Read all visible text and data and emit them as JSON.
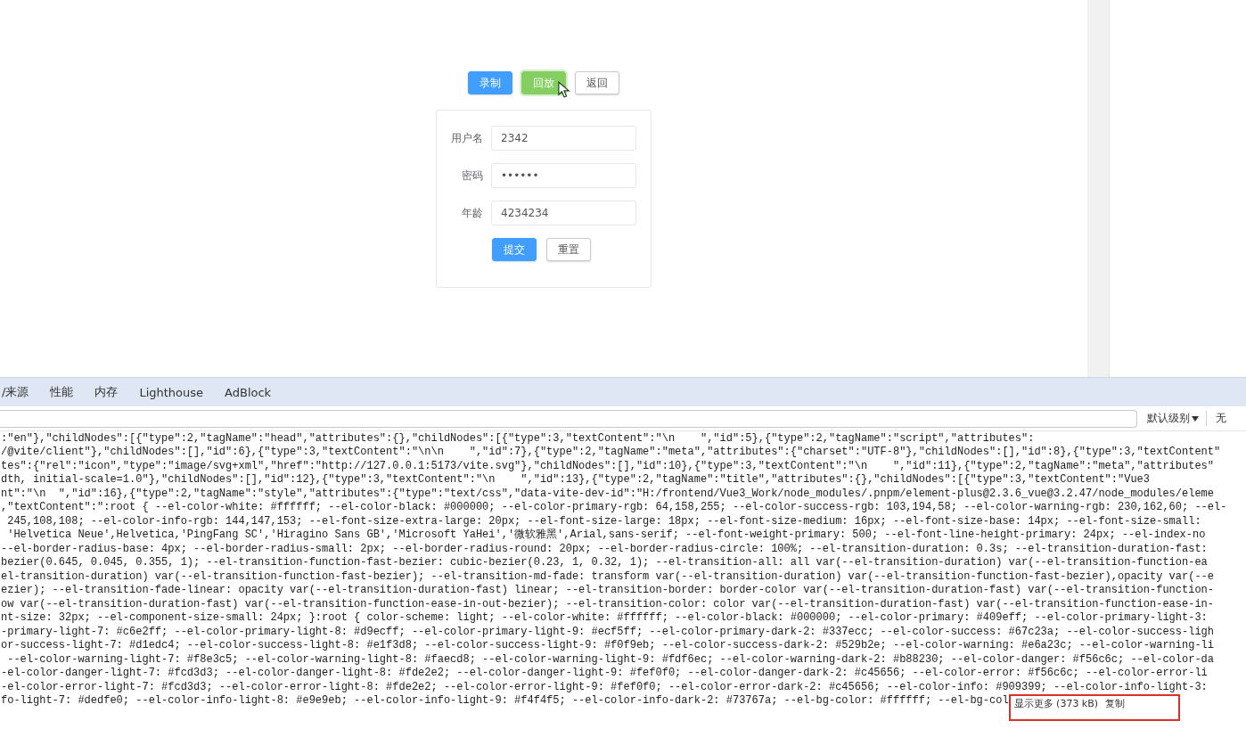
{
  "page": {
    "toolbar_buttons": [
      {
        "label": "录制",
        "kind": "primary",
        "hovered": false
      },
      {
        "label": "回放",
        "kind": "success",
        "hovered": true
      },
      {
        "label": "返回",
        "kind": "plain",
        "hovered": false
      }
    ],
    "form": {
      "fields": [
        {
          "label": "用户名",
          "value": "2342"
        },
        {
          "label": "密码",
          "value": "••••••"
        },
        {
          "label": "年龄",
          "value": "4234234"
        }
      ],
      "buttons": [
        {
          "label": "提交",
          "kind": "primary"
        },
        {
          "label": "重置",
          "kind": "plain"
        }
      ]
    }
  },
  "devtools": {
    "tabs": [
      {
        "label": "/来源",
        "selected": false
      },
      {
        "label": "性能",
        "selected": false
      },
      {
        "label": "内存",
        "selected": false
      },
      {
        "label": "Lighthouse",
        "selected": false
      },
      {
        "label": "AdBlock",
        "selected": false
      }
    ],
    "level_dropdown": "默认级别",
    "cut_label": "无",
    "console_lines": [
      ":\"en\"},\"childNodes\":[{\"type\":2,\"tagName\":\"head\",\"attributes\":{},\"childNodes\":[{\"type\":3,\"textContent\":\"\\n    \",\"id\":5},{\"type\":2,\"tagName\":\"script\",\"attributes\":",
      "/@vite/client\"},\"childNodes\":[],\"id\":6},{\"type\":3,\"textContent\":\"\\n\\n    \",\"id\":7},{\"type\":2,\"tagName\":\"meta\",\"attributes\":{\"charset\":\"UTF-8\"},\"childNodes\":[],\"id\":8},{\"type\":3,\"textContent\"",
      "tes\":{\"rel\":\"icon\",\"type\":\"image/svg+xml\",\"href\":\"http://127.0.0.1:5173/vite.svg\"},\"childNodes\":[],\"id\":10},{\"type\":3,\"textContent\":\"\\n    \",\"id\":11},{\"type\":2,\"tagName\":\"meta\",\"attributes\"",
      "dth, initial-scale=1.0\"},\"childNodes\":[],\"id\":12},{\"type\":3,\"textContent\":\"\\n    \",\"id\":13},{\"type\":2,\"tagName\":\"title\",\"attributes\":{},\"childNodes\":[{\"type\":3,\"textContent\":\"Vue3",
      "nt\":\"\\n  \",\"id\":16},{\"type\":2,\"tagName\":\"style\",\"attributes\":{\"type\":\"text/css\",\"data-vite-dev-id\":\"H:/frontend/Vue3_Work/node_modules/.pnpm/element-plus@2.3.6_vue@3.2.47/node_modules/eleme",
      ",\"textContent\":\":root { --el-color-white: #ffffff; --el-color-black: #000000; --el-color-primary-rgb: 64,158,255; --el-color-success-rgb: 103,194,58; --el-color-warning-rgb: 230,162,60; --el-",
      " 245,108,108; --el-color-info-rgb: 144,147,153; --el-font-size-extra-large: 20px; --el-font-size-large: 18px; --el-font-size-medium: 16px; --el-font-size-base: 14px; --el-font-size-small:",
      " 'Helvetica Neue',Helvetica,'PingFang SC','Hiragino Sans GB','Microsoft YaHei','微软雅黑',Arial,sans-serif; --el-font-weight-primary: 500; --el-font-line-height-primary: 24px; --el-index-no",
      "--el-border-radius-base: 4px; --el-border-radius-small: 2px; --el-border-radius-round: 20px; --el-border-radius-circle: 100%; --el-transition-duration: 0.3s; --el-transition-duration-fast:",
      "bezier(0.645, 0.045, 0.355, 1); --el-transition-function-fast-bezier: cubic-bezier(0.23, 1, 0.32, 1); --el-transition-all: all var(--el-transition-duration) var(--el-transition-function-ea",
      "el-transition-duration) var(--el-transition-function-fast-bezier); --el-transition-md-fade: transform var(--el-transition-duration) var(--el-transition-function-fast-bezier),opacity var(--e",
      "ezier); --el-transition-fade-linear: opacity var(--el-transition-duration-fast) linear; --el-transition-border: border-color var(--el-transition-duration-fast) var(--el-transition-function-",
      "ow var(--el-transition-duration-fast) var(--el-transition-function-ease-in-out-bezier); --el-transition-color: color var(--el-transition-duration-fast) var(--el-transition-function-ease-in-",
      "nt-size: 32px; --el-component-size-small: 24px; }:root { color-scheme: light; --el-color-white: #ffffff; --el-color-black: #000000; --el-color-primary: #409eff; --el-color-primary-light-3:",
      "-primary-light-7: #c6e2ff; --el-color-primary-light-8: #d9ecff; --el-color-primary-light-9: #ecf5ff; --el-color-primary-dark-2: #337ecc; --el-color-success: #67c23a; --el-color-success-ligh",
      "or-success-light-7: #d1edc4; --el-color-success-light-8: #e1f3d8; --el-color-success-light-9: #f0f9eb; --el-color-success-dark-2: #529b2e; --el-color-warning: #e6a23c; --el-color-warning-li",
      " --el-color-warning-light-7: #f8e3c5; --el-color-warning-light-8: #faecd8; --el-color-warning-light-9: #fdf6ec; --el-color-warning-dark-2: #b88230; --el-color-danger: #f56c6c; --el-color-da",
      "-el-color-danger-light-7: #fcd3d3; --el-color-danger-light-8: #fde2e2; --el-color-danger-light-9: #fef0f0; --el-color-danger-dark-2: #c45656; --el-color-error: #f56c6c; --el-color-error-li",
      "-el-color-error-light-7: #fcd3d3; --el-color-error-light-8: #fde2e2; --el-color-error-light-9: #fef0f0; --el-color-error-dark-2: #c45656; --el-color-info: #909399; --el-color-info-light-3:",
      "fo-light-7: #dedfe0; --el-color-info-light-8: #e9e9eb; --el-color-info-light-9: #f4f4f5; --el-color-info-dark-2: #73767a; --el-bg-color: #ffffff; --el-bg-col"
    ],
    "show_more": "显示更多 (373 kB)",
    "copy": "复制",
    "highlight": true
  }
}
